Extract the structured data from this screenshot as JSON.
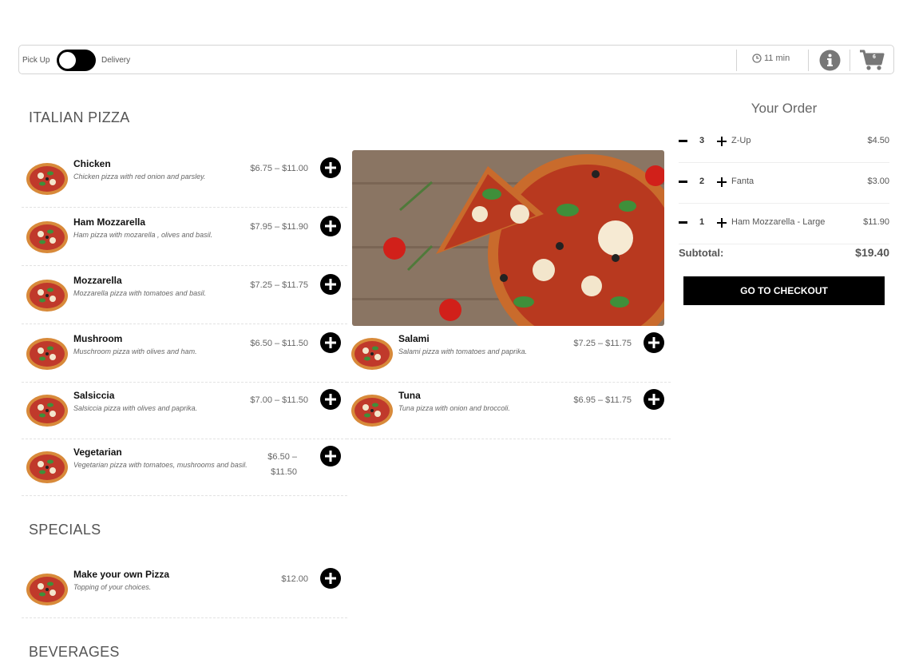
{
  "topbar": {
    "pickup_label": "Pick Up",
    "delivery_label": "Delivery",
    "wait_time": "11 min",
    "cart_count": "6"
  },
  "sections": {
    "italian_pizza": "ITALIAN PIZZA",
    "specials": "SPECIALS",
    "beverages": "BEVERAGES"
  },
  "pizzas_left": [
    {
      "name": "Chicken",
      "desc": "Chicken pizza with red onion and parsley.",
      "price": "$6.75 – $11.00"
    },
    {
      "name": "Ham Mozzarella",
      "desc": "Ham pizza with mozarella , olives and basil.",
      "price": "$7.95 – $11.90"
    },
    {
      "name": "Mozzarella",
      "desc": "Mozzarella pizza with tomatoes and basil.",
      "price": "$7.25 – $11.75"
    },
    {
      "name": "Mushroom",
      "desc": "Muschroom pizza with olives and ham.",
      "price": "$6.50 – $11.50"
    },
    {
      "name": "Salsiccia",
      "desc": "Salsiccia pizza with olives and paprika.",
      "price": "$7.00 – $11.50"
    },
    {
      "name": "Vegetarian",
      "desc": "Vegetarian pizza with tomatoes, mushrooms and basil.",
      "price": "$6.50 – $11.50"
    }
  ],
  "pizzas_right": [
    {
      "name": "Salami",
      "desc": "Salami pizza with tomatoes and paprika.",
      "price": "$7.25 – $11.75"
    },
    {
      "name": "Tuna",
      "desc": "Tuna pizza with onion and broccoli.",
      "price": "$6.95 – $11.75"
    }
  ],
  "specials_items": [
    {
      "name": "Make your own Pizza",
      "desc": "Topping of your choices.",
      "price": "$12.00"
    }
  ],
  "order": {
    "title": "Your Order",
    "lines": [
      {
        "qty": "3",
        "name": "Z-Up",
        "price": "$4.50"
      },
      {
        "qty": "2",
        "name": "Fanta",
        "price": "$3.00"
      },
      {
        "qty": "1",
        "name": "Ham Mozzarella - Large",
        "price": "$11.90"
      }
    ],
    "subtotal_label": "Subtotal:",
    "subtotal_value": "$19.40",
    "checkout_label": "GO TO CHECKOUT"
  },
  "colors": {
    "accent": "#000000",
    "crust": "#d88a3a",
    "sauce": "#c0392b",
    "basil": "#3f8f3a",
    "board": "#8a7563"
  }
}
